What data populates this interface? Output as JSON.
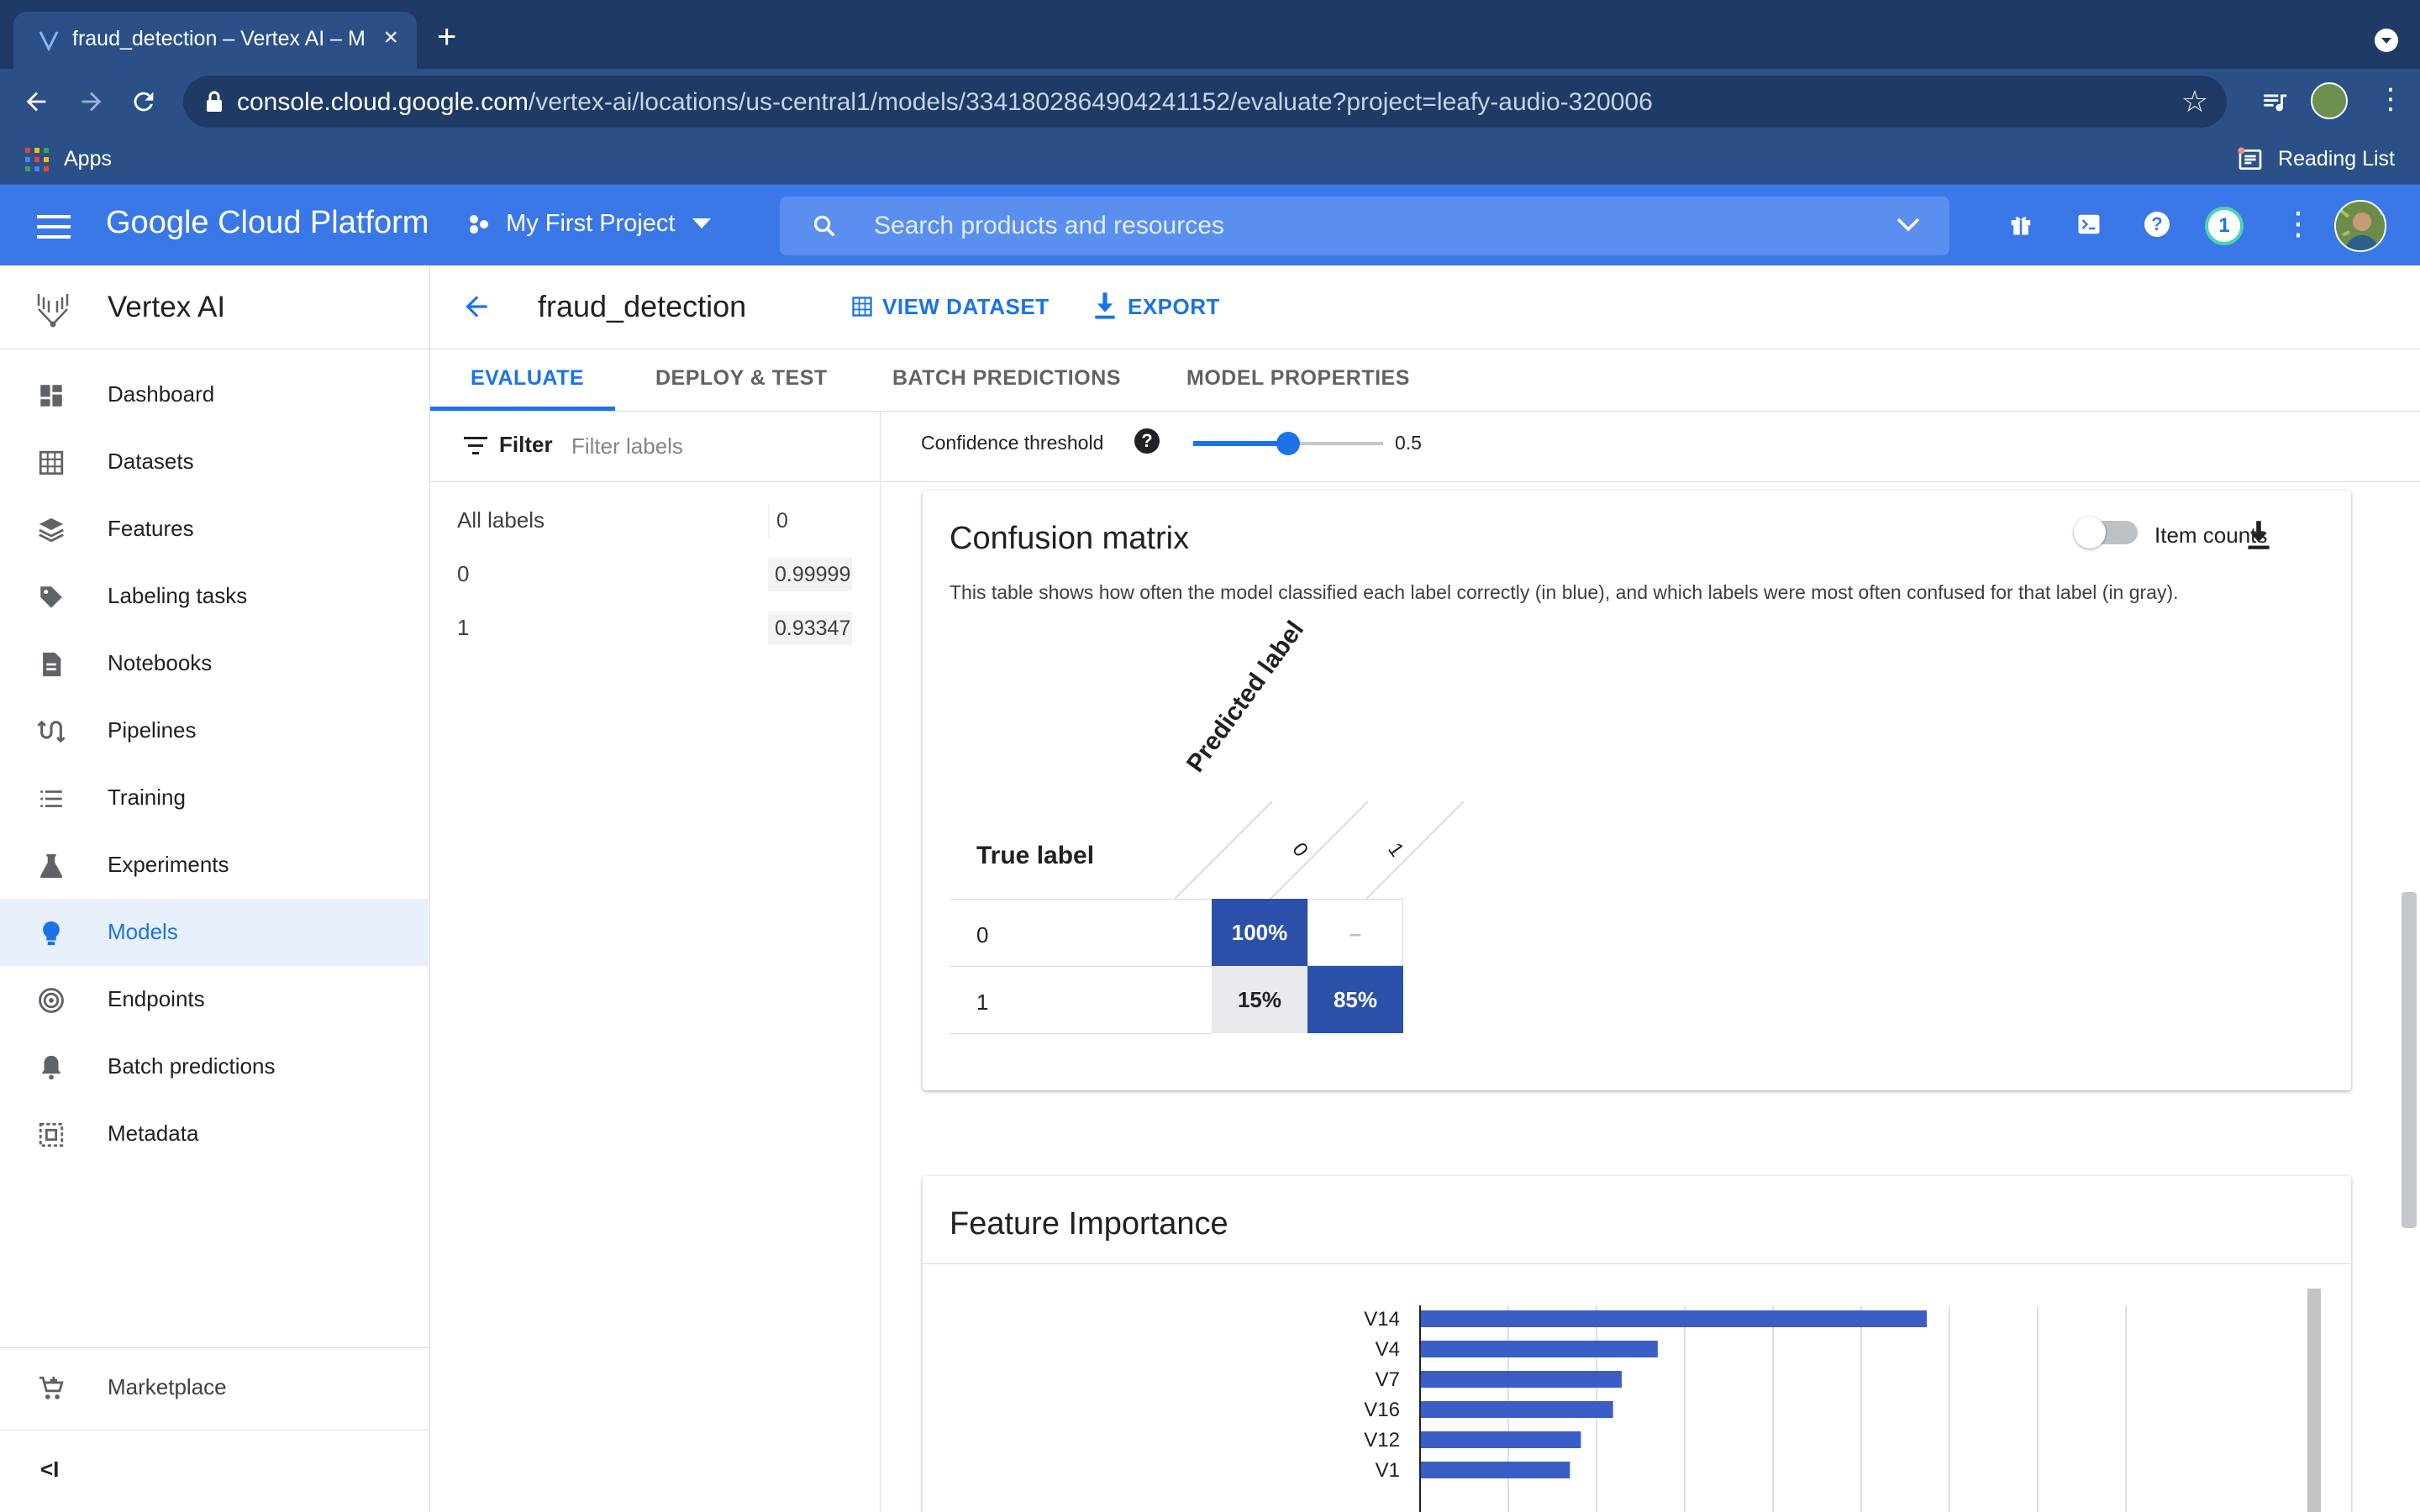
{
  "browser": {
    "tab_title": "fraud_detection – Vertex AI – M",
    "tab_close": "×",
    "new_tab": "+",
    "url_host": "console.cloud.google.com",
    "url_path": "/vertex-ai/locations/us-central1/models/3341802864904241152/evaluate?project=leafy-audio-320006",
    "bookmark_apps": "Apps",
    "reading_list": "Reading List"
  },
  "header": {
    "platform_title": "Google Cloud Platform",
    "project": "My First Project",
    "search_placeholder": "Search products and resources",
    "notification_count": "1"
  },
  "sidebar": {
    "product": "Vertex AI",
    "items": [
      {
        "label": "Dashboard",
        "icon": "dashboard-icon"
      },
      {
        "label": "Datasets",
        "icon": "datasets-icon"
      },
      {
        "label": "Features",
        "icon": "features-icon"
      },
      {
        "label": "Labeling tasks",
        "icon": "tag-icon"
      },
      {
        "label": "Notebooks",
        "icon": "notebook-icon"
      },
      {
        "label": "Pipelines",
        "icon": "pipelines-icon"
      },
      {
        "label": "Training",
        "icon": "training-icon"
      },
      {
        "label": "Experiments",
        "icon": "flask-icon"
      },
      {
        "label": "Models",
        "icon": "lightbulb-icon",
        "active": true
      },
      {
        "label": "Endpoints",
        "icon": "endpoints-icon"
      },
      {
        "label": "Batch predictions",
        "icon": "bell-icon"
      },
      {
        "label": "Metadata",
        "icon": "metadata-icon"
      }
    ],
    "marketplace": "Marketplace",
    "collapse": "<I"
  },
  "page": {
    "model_name": "fraud_detection",
    "view_dataset": "VIEW DATASET",
    "export": "EXPORT",
    "tabs": [
      "EVALUATE",
      "DEPLOY & TEST",
      "BATCH PREDICTIONS",
      "MODEL PROPERTIES"
    ],
    "active_tab": "EVALUATE"
  },
  "filter": {
    "label": "Filter",
    "placeholder": "Filter labels",
    "rows": [
      {
        "name": "All labels",
        "value": "0"
      },
      {
        "name": "0",
        "value": "0.99999"
      },
      {
        "name": "1",
        "value": "0.93347"
      }
    ]
  },
  "threshold": {
    "label": "Confidence threshold",
    "help": "?",
    "value": "0.5",
    "fraction": 0.5
  },
  "confusion_matrix": {
    "title": "Confusion matrix",
    "description": "This table shows how often the model classified each label correctly (in blue), and which labels were most often confused for that label (in gray).",
    "item_counts_label": "Item counts",
    "item_counts_on": false,
    "true_label": "True label",
    "predicted_label": "Predicted label",
    "columns": [
      "0",
      "1"
    ],
    "rows": [
      {
        "label": "0",
        "cells": [
          "100%",
          "–"
        ]
      },
      {
        "label": "1",
        "cells": [
          "15%",
          "85%"
        ]
      }
    ],
    "colors": {
      "correct": "#2b50aa",
      "confused": "#e8eaed"
    }
  },
  "feature_importance": {
    "title": "Feature Importance"
  },
  "chart_data": {
    "type": "bar",
    "orientation": "horizontal",
    "categories": [
      "V14",
      "V4",
      "V7",
      "V16",
      "V12",
      "V1"
    ],
    "values": [
      64.5,
      30.2,
      25.6,
      24.5,
      20.4,
      19.0
    ],
    "xlim": [
      0,
      90
    ],
    "grid": true,
    "color": "#3b5ec6"
  }
}
